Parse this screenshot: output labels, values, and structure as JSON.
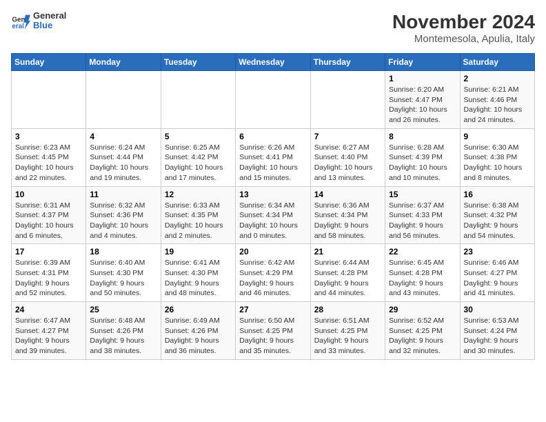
{
  "header": {
    "logo_general": "General",
    "logo_blue": "Blue",
    "title": "November 2024",
    "subtitle": "Montemesola, Apulia, Italy"
  },
  "days_of_week": [
    "Sunday",
    "Monday",
    "Tuesday",
    "Wednesday",
    "Thursday",
    "Friday",
    "Saturday"
  ],
  "weeks": [
    [
      {
        "day": "",
        "info": ""
      },
      {
        "day": "",
        "info": ""
      },
      {
        "day": "",
        "info": ""
      },
      {
        "day": "",
        "info": ""
      },
      {
        "day": "",
        "info": ""
      },
      {
        "day": "1",
        "info": "Sunrise: 6:20 AM\nSunset: 4:47 PM\nDaylight: 10 hours and 26 minutes."
      },
      {
        "day": "2",
        "info": "Sunrise: 6:21 AM\nSunset: 4:46 PM\nDaylight: 10 hours and 24 minutes."
      }
    ],
    [
      {
        "day": "3",
        "info": "Sunrise: 6:23 AM\nSunset: 4:45 PM\nDaylight: 10 hours and 22 minutes."
      },
      {
        "day": "4",
        "info": "Sunrise: 6:24 AM\nSunset: 4:44 PM\nDaylight: 10 hours and 19 minutes."
      },
      {
        "day": "5",
        "info": "Sunrise: 6:25 AM\nSunset: 4:42 PM\nDaylight: 10 hours and 17 minutes."
      },
      {
        "day": "6",
        "info": "Sunrise: 6:26 AM\nSunset: 4:41 PM\nDaylight: 10 hours and 15 minutes."
      },
      {
        "day": "7",
        "info": "Sunrise: 6:27 AM\nSunset: 4:40 PM\nDaylight: 10 hours and 13 minutes."
      },
      {
        "day": "8",
        "info": "Sunrise: 6:28 AM\nSunset: 4:39 PM\nDaylight: 10 hours and 10 minutes."
      },
      {
        "day": "9",
        "info": "Sunrise: 6:30 AM\nSunset: 4:38 PM\nDaylight: 10 hours and 8 minutes."
      }
    ],
    [
      {
        "day": "10",
        "info": "Sunrise: 6:31 AM\nSunset: 4:37 PM\nDaylight: 10 hours and 6 minutes."
      },
      {
        "day": "11",
        "info": "Sunrise: 6:32 AM\nSunset: 4:36 PM\nDaylight: 10 hours and 4 minutes."
      },
      {
        "day": "12",
        "info": "Sunrise: 6:33 AM\nSunset: 4:35 PM\nDaylight: 10 hours and 2 minutes."
      },
      {
        "day": "13",
        "info": "Sunrise: 6:34 AM\nSunset: 4:34 PM\nDaylight: 10 hours and 0 minutes."
      },
      {
        "day": "14",
        "info": "Sunrise: 6:36 AM\nSunset: 4:34 PM\nDaylight: 9 hours and 58 minutes."
      },
      {
        "day": "15",
        "info": "Sunrise: 6:37 AM\nSunset: 4:33 PM\nDaylight: 9 hours and 56 minutes."
      },
      {
        "day": "16",
        "info": "Sunrise: 6:38 AM\nSunset: 4:32 PM\nDaylight: 9 hours and 54 minutes."
      }
    ],
    [
      {
        "day": "17",
        "info": "Sunrise: 6:39 AM\nSunset: 4:31 PM\nDaylight: 9 hours and 52 minutes."
      },
      {
        "day": "18",
        "info": "Sunrise: 6:40 AM\nSunset: 4:30 PM\nDaylight: 9 hours and 50 minutes."
      },
      {
        "day": "19",
        "info": "Sunrise: 6:41 AM\nSunset: 4:30 PM\nDaylight: 9 hours and 48 minutes."
      },
      {
        "day": "20",
        "info": "Sunrise: 6:42 AM\nSunset: 4:29 PM\nDaylight: 9 hours and 46 minutes."
      },
      {
        "day": "21",
        "info": "Sunrise: 6:44 AM\nSunset: 4:28 PM\nDaylight: 9 hours and 44 minutes."
      },
      {
        "day": "22",
        "info": "Sunrise: 6:45 AM\nSunset: 4:28 PM\nDaylight: 9 hours and 43 minutes."
      },
      {
        "day": "23",
        "info": "Sunrise: 6:46 AM\nSunset: 4:27 PM\nDaylight: 9 hours and 41 minutes."
      }
    ],
    [
      {
        "day": "24",
        "info": "Sunrise: 6:47 AM\nSunset: 4:27 PM\nDaylight: 9 hours and 39 minutes."
      },
      {
        "day": "25",
        "info": "Sunrise: 6:48 AM\nSunset: 4:26 PM\nDaylight: 9 hours and 38 minutes."
      },
      {
        "day": "26",
        "info": "Sunrise: 6:49 AM\nSunset: 4:26 PM\nDaylight: 9 hours and 36 minutes."
      },
      {
        "day": "27",
        "info": "Sunrise: 6:50 AM\nSunset: 4:25 PM\nDaylight: 9 hours and 35 minutes."
      },
      {
        "day": "28",
        "info": "Sunrise: 6:51 AM\nSunset: 4:25 PM\nDaylight: 9 hours and 33 minutes."
      },
      {
        "day": "29",
        "info": "Sunrise: 6:52 AM\nSunset: 4:25 PM\nDaylight: 9 hours and 32 minutes."
      },
      {
        "day": "30",
        "info": "Sunrise: 6:53 AM\nSunset: 4:24 PM\nDaylight: 9 hours and 30 minutes."
      }
    ]
  ]
}
